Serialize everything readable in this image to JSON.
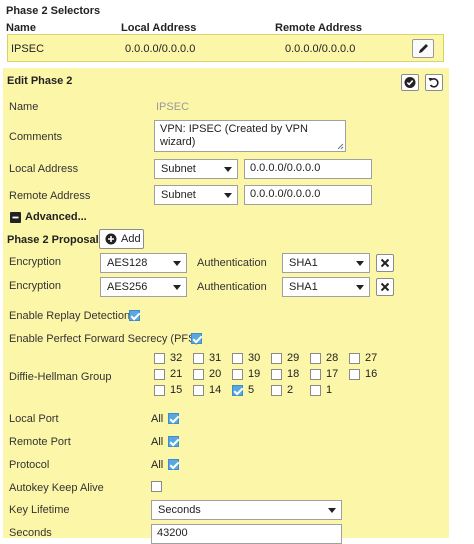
{
  "selectors": {
    "title": "Phase 2 Selectors",
    "col_name": "Name",
    "col_local": "Local Address",
    "col_remote": "Remote Address",
    "row": {
      "name": "IPSEC",
      "local": "0.0.0.0/0.0.0.0",
      "remote": "0.0.0.0/0.0.0.0"
    }
  },
  "edit": {
    "title": "Edit Phase 2",
    "name_label": "Name",
    "name_value": "IPSEC",
    "comments_label": "Comments",
    "comments_value": "VPN: IPSEC (Created by VPN wizard)",
    "local_label": "Local Address",
    "local_type": "Subnet",
    "local_value": "0.0.0.0/0.0.0.0",
    "remote_label": "Remote Address",
    "remote_type": "Subnet",
    "remote_value": "0.0.0.0/0.0.0.0",
    "advanced_label": "Advanced...",
    "proposal_label": "Phase 2 Proposal",
    "add_label": "Add",
    "proposals": [
      {
        "enc_label": "Encryption",
        "enc": "AES128",
        "auth_label": "Authentication",
        "auth": "SHA1"
      },
      {
        "enc_label": "Encryption",
        "enc": "AES256",
        "auth_label": "Authentication",
        "auth": "SHA1"
      }
    ],
    "replay_label": "Enable Replay Detection",
    "replay_checked": true,
    "pfs_label": "Enable Perfect Forward Secrecy (PFS)",
    "pfs_checked": true,
    "dh_label": "Diffie-Hellman Group",
    "dh_groups": [
      {
        "num": "32",
        "checked": false
      },
      {
        "num": "31",
        "checked": false
      },
      {
        "num": "30",
        "checked": false
      },
      {
        "num": "29",
        "checked": false
      },
      {
        "num": "28",
        "checked": false
      },
      {
        "num": "27",
        "checked": false
      },
      {
        "num": "21",
        "checked": false
      },
      {
        "num": "20",
        "checked": false
      },
      {
        "num": "19",
        "checked": false
      },
      {
        "num": "18",
        "checked": false
      },
      {
        "num": "17",
        "checked": false
      },
      {
        "num": "16",
        "checked": false
      },
      {
        "num": "15",
        "checked": false
      },
      {
        "num": "14",
        "checked": false
      },
      {
        "num": "5",
        "checked": true
      },
      {
        "num": "2",
        "checked": false
      },
      {
        "num": "1",
        "checked": false
      }
    ],
    "local_port_label": "Local Port",
    "local_port_value": "All",
    "remote_port_label": "Remote Port",
    "remote_port_value": "All",
    "protocol_label": "Protocol",
    "protocol_value": "All",
    "autokey_label": "Autokey Keep Alive",
    "autokey_checked": false,
    "key_lifetime_label": "Key Lifetime",
    "key_lifetime_value": "Seconds",
    "seconds_label": "Seconds",
    "seconds_value": "43200"
  },
  "colors": {
    "panel": "#fcf7a8",
    "check": "#5aa8e0"
  },
  "icons": {
    "edit": "pencil-icon",
    "ok": "check-circle-icon",
    "undo": "undo-icon",
    "add": "plus-circle-icon",
    "remove": "x-icon",
    "advanced": "minus-square-icon"
  }
}
